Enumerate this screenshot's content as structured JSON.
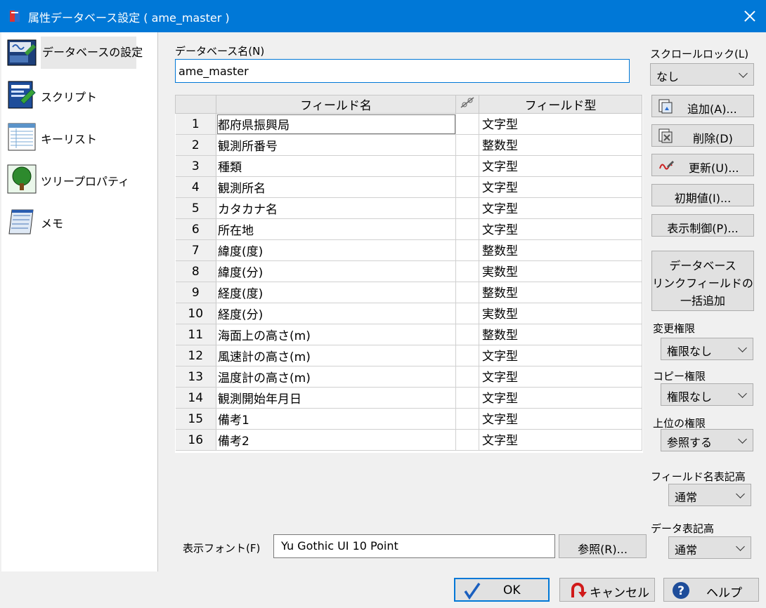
{
  "window": {
    "title": "属性データベース設定 ( ame_master )"
  },
  "sidebar": {
    "items": [
      {
        "label": "データベースの設定",
        "icon": "database-settings-icon"
      },
      {
        "label": "スクリプト",
        "icon": "script-icon"
      },
      {
        "label": "キーリスト",
        "icon": "key-list-icon"
      },
      {
        "label": "ツリープロパティ",
        "icon": "tree-icon"
      },
      {
        "label": "メモ",
        "icon": "memo-icon"
      }
    ]
  },
  "dbname": {
    "label": "データベース名(N)",
    "value": "ame_master"
  },
  "grid": {
    "headers": {
      "field_name": "フィールド名",
      "field_type": "フィールド型"
    },
    "rows": [
      {
        "n": "1",
        "name": "都府県振興局",
        "type": "文字型"
      },
      {
        "n": "2",
        "name": "観測所番号",
        "type": "整数型"
      },
      {
        "n": "3",
        "name": "種類",
        "type": "文字型"
      },
      {
        "n": "4",
        "name": "観測所名",
        "type": "文字型"
      },
      {
        "n": "5",
        "name": "カタカナ名",
        "type": "文字型"
      },
      {
        "n": "6",
        "name": "所在地",
        "type": "文字型"
      },
      {
        "n": "7",
        "name": "緯度(度)",
        "type": "整数型"
      },
      {
        "n": "8",
        "name": "緯度(分)",
        "type": "実数型"
      },
      {
        "n": "9",
        "name": "経度(度)",
        "type": "整数型"
      },
      {
        "n": "10",
        "name": "経度(分)",
        "type": "実数型"
      },
      {
        "n": "11",
        "name": "海面上の高さ(m)",
        "type": "整数型"
      },
      {
        "n": "12",
        "name": "風速計の高さ(m)",
        "type": "文字型"
      },
      {
        "n": "13",
        "name": "温度計の高さ(m)",
        "type": "文字型"
      },
      {
        "n": "14",
        "name": "観測開始年月日",
        "type": "文字型"
      },
      {
        "n": "15",
        "name": "備考1",
        "type": "文字型"
      },
      {
        "n": "16",
        "name": "備考2",
        "type": "文字型"
      }
    ]
  },
  "right": {
    "scroll_lock": {
      "label": "スクロールロック(L)",
      "value": "なし"
    },
    "add_label": "追加(A)...",
    "delete_label": "削除(D)",
    "update_label": "更新(U)...",
    "initial_label": "初期値(I)...",
    "display_label": "表示制御(P)...",
    "link_label": [
      "データベース",
      "リンクフィールドの",
      "一括追加"
    ],
    "change_perm": {
      "label": "変更権限",
      "value": "権限なし"
    },
    "copy_perm": {
      "label": "コピー権限",
      "value": "権限なし"
    },
    "parent_perm": {
      "label": "上位の権限",
      "value": "参照する"
    },
    "fieldname_height": {
      "label": "フィールド名表記高",
      "value": "通常"
    },
    "data_height": {
      "label": "データ表記高",
      "value": "通常"
    }
  },
  "font": {
    "label": "表示フォント(F)",
    "value": "Yu Gothic UI 10 Point",
    "browse_label": "参照(R)..."
  },
  "footer": {
    "ok": "OK",
    "cancel": "キャンセル",
    "help": "ヘルプ"
  }
}
